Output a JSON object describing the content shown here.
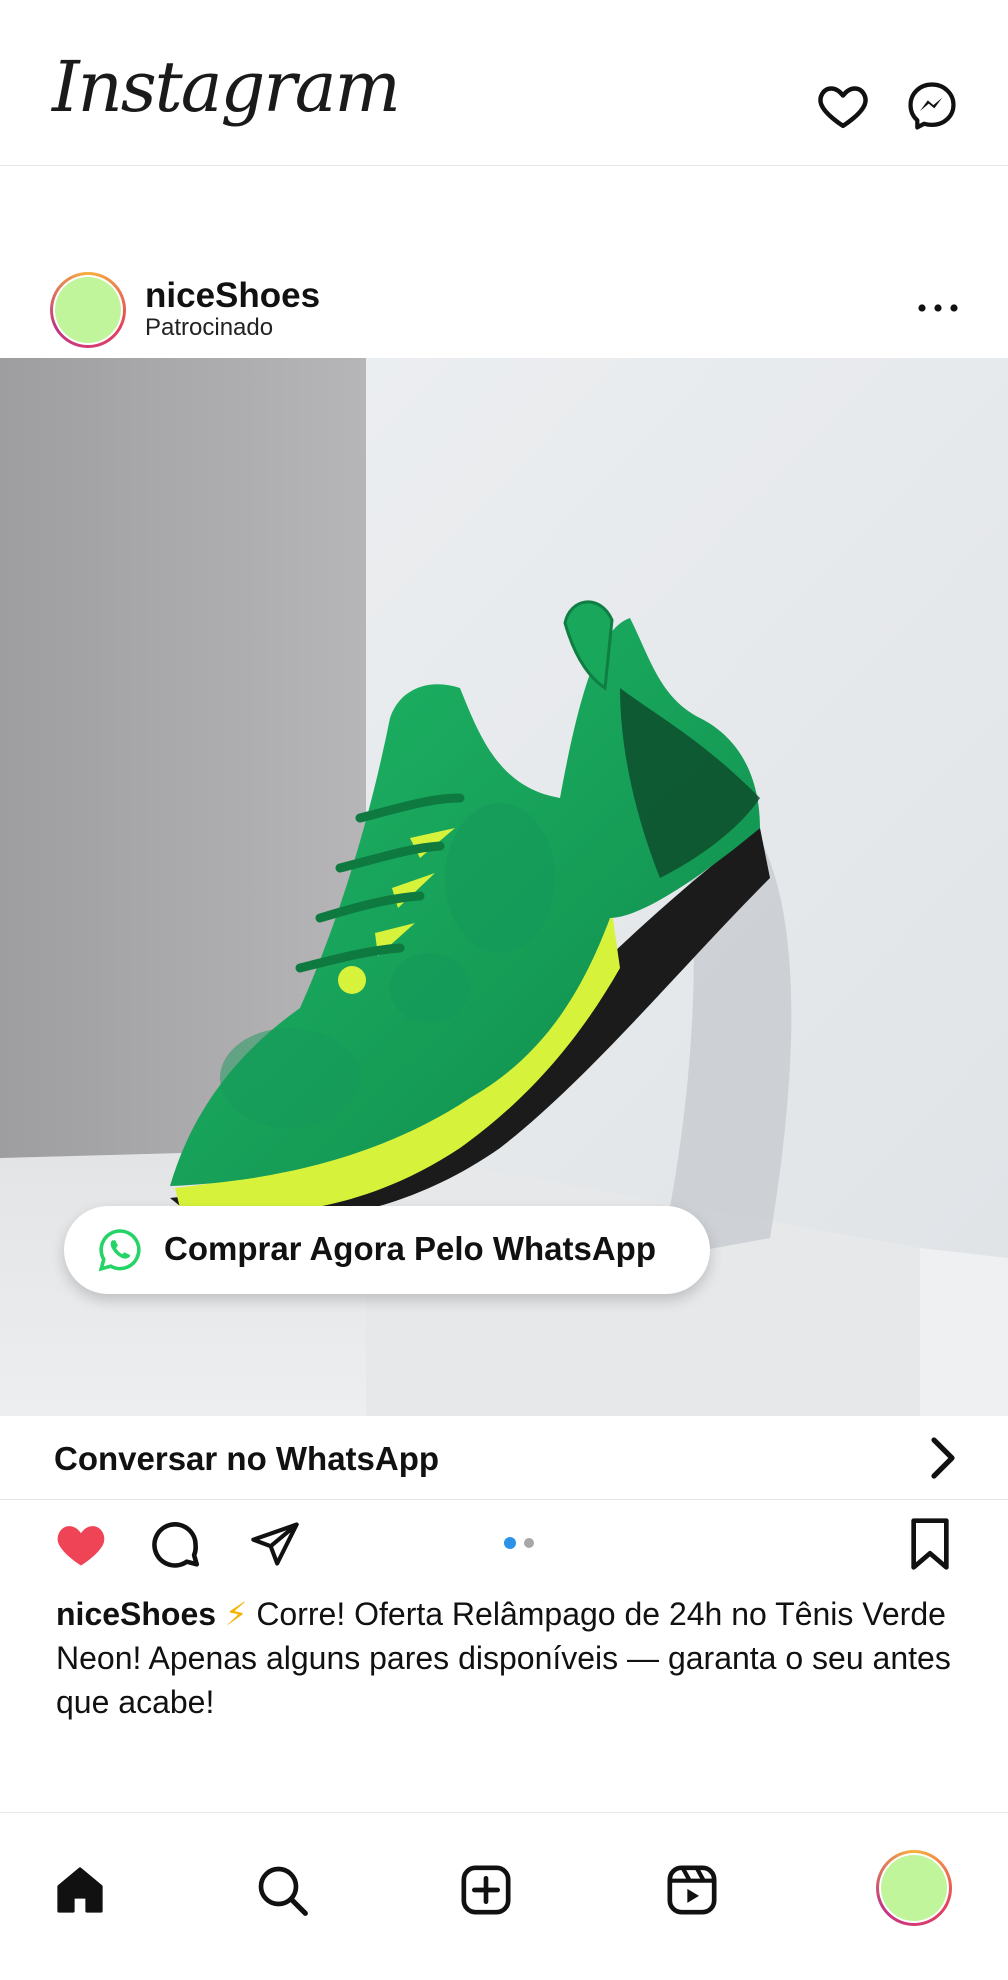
{
  "app": {
    "logo_text": "Instagram"
  },
  "header": {
    "icons": [
      "heart-icon",
      "messenger-icon"
    ]
  },
  "post": {
    "username": "niceShoes",
    "sponsored_label": "Patrocinado",
    "cta_pill_label": "Comprar Agora Pelo WhatsApp",
    "whatsapp_row_label": "Conversar no WhatsApp",
    "liked": true,
    "carousel": {
      "count": 2,
      "active": 1
    },
    "caption": {
      "username": "niceShoes",
      "emoji": "⚡",
      "text": " Corre! Oferta Relâmpago de 24h no Tênis Verde Neon! Apenas alguns pares disponíveis — garanta o seu antes que acabe!"
    }
  },
  "bottom_nav": {
    "items": [
      "home-icon",
      "search-icon",
      "create-icon",
      "reels-icon",
      "profile-avatar"
    ]
  },
  "colors": {
    "like_red": "#ef4456",
    "carousel_active": "#2a93e8",
    "avatar_fill": "#c0f59c",
    "whatsapp_green": "#25d366",
    "shoe_green": "#17a25a",
    "neon_yellow": "#d7f23a"
  }
}
